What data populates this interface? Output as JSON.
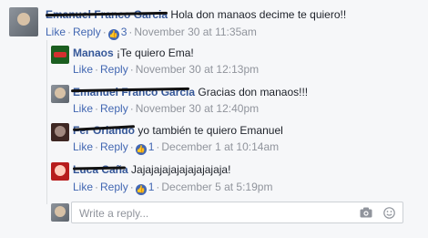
{
  "comments": [
    {
      "author": "Emanuel Franco Garcia",
      "text": "Hola don manaos decime te quiero!!",
      "like": "Like",
      "reply": "Reply",
      "likes": "3",
      "time": "November 30 at 11:35am"
    },
    {
      "author": "Manaos",
      "text": "¡Te quiero Ema!",
      "like": "Like",
      "reply": "Reply",
      "likes": "",
      "time": "November 30 at 12:13pm"
    },
    {
      "author": "Emanuel Franco Garcia",
      "text": "Gracias don manaos!!!",
      "like": "Like",
      "reply": "Reply",
      "likes": "",
      "time": "November 30 at 12:40pm"
    },
    {
      "author": "Fer Orlando",
      "text": "yo también te quiero Emanuel",
      "like": "Like",
      "reply": "Reply",
      "likes": "1",
      "time": "December 1 at 10:14am"
    },
    {
      "author": "Luca Caña",
      "text": "Jajajajajajajajajajaja!",
      "like": "Like",
      "reply": "Reply",
      "likes": "1",
      "time": "December 5 at 5:19pm"
    }
  ],
  "reply_box": {
    "placeholder": "Write a reply..."
  },
  "separator": "·",
  "colors": {
    "link": "#4267b2",
    "author": "#365899",
    "meta": "#90949c",
    "background": "#f6f7f9"
  },
  "icons": [
    "camera-icon",
    "sticker-icon",
    "thumbs-up-icon"
  ]
}
